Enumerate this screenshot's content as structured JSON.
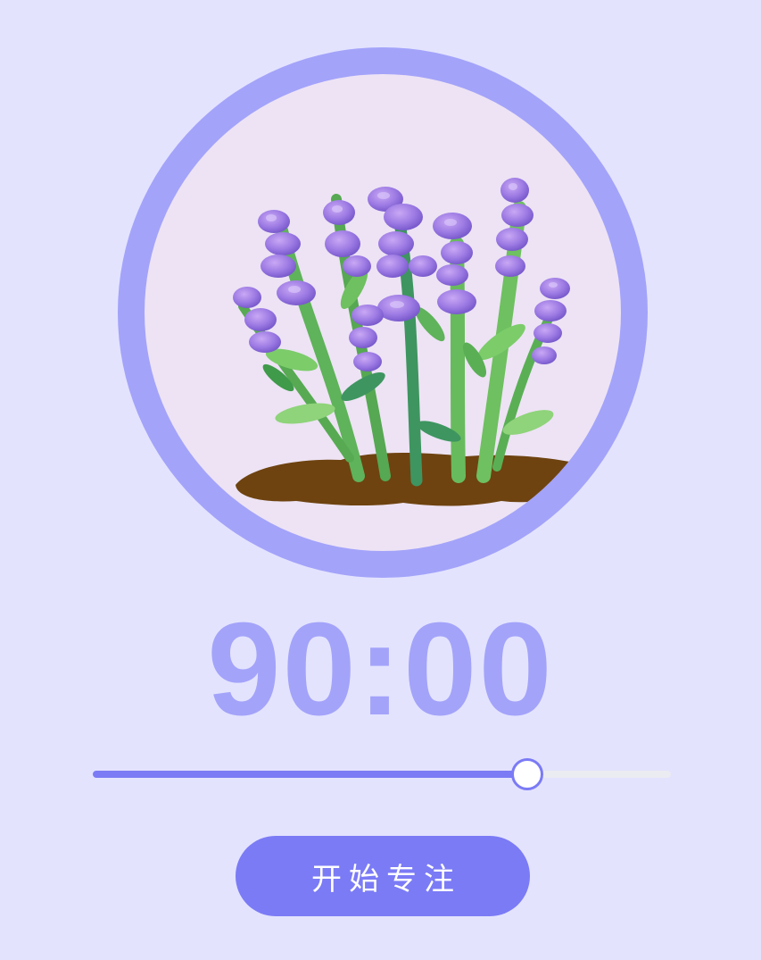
{
  "timer": {
    "display": "90:00"
  },
  "slider": {
    "value_fraction": 0.752
  },
  "start_button": {
    "label": "开始专注"
  },
  "plant": {
    "icon": "lavender-plant-icon"
  },
  "colors": {
    "background": "#e3e3fe",
    "ring": "#a3a3fa",
    "disc": "#ede3f4",
    "accent": "#7b7bf6",
    "timer_text": "#a3a3fa",
    "soil": "#6e4310",
    "stem": "#5fb35a",
    "flower": "#9b7ae0"
  }
}
